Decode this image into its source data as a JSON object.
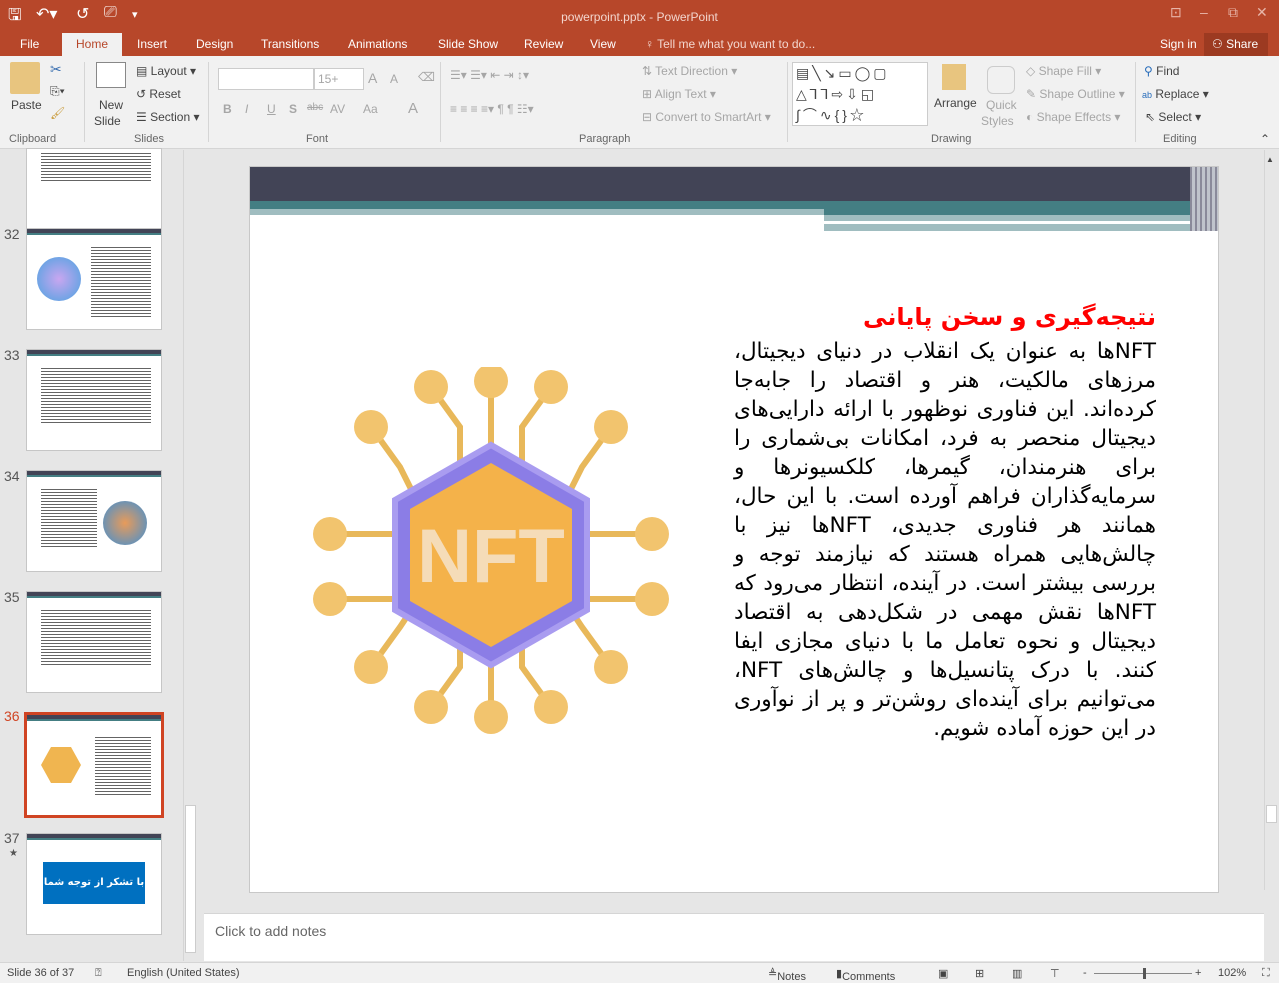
{
  "window": {
    "title": "powerpoint.pptx - PowerPoint"
  },
  "tabs": [
    {
      "label": "File"
    },
    {
      "label": "Home"
    },
    {
      "label": "Insert"
    },
    {
      "label": "Design"
    },
    {
      "label": "Transitions"
    },
    {
      "label": "Animations"
    },
    {
      "label": "Slide Show"
    },
    {
      "label": "Review"
    },
    {
      "label": "View"
    }
  ],
  "tell_me": "Tell me what you want to do...",
  "sign_in": "Sign in",
  "share": "Share",
  "ribbon": {
    "clipboard": {
      "label": "Clipboard",
      "paste": "Paste"
    },
    "slides": {
      "label": "Slides",
      "new_slide": "New",
      "new_slide2": "Slide",
      "layout": "Layout",
      "reset": "Reset",
      "section": "Section"
    },
    "font": {
      "label": "Font",
      "size": "15+",
      "bold": "B",
      "italic": "I",
      "underline": "U",
      "shadow": "S",
      "strike": "abc",
      "spacing": "AV",
      "case": "Aa",
      "color": "A",
      "grow": "A",
      "shrink": "A"
    },
    "paragraph": {
      "label": "Paragraph",
      "text_direction": "Text Direction",
      "align_text": "Align Text",
      "smartart": "Convert to SmartArt"
    },
    "drawing": {
      "label": "Drawing",
      "arrange": "Arrange",
      "quick_styles": "Quick",
      "quick_styles2": "Styles",
      "shape_fill": "Shape Fill",
      "shape_outline": "Shape Outline",
      "shape_effects": "Shape Effects"
    },
    "editing": {
      "label": "Editing",
      "find": "Find",
      "replace": "Replace",
      "select": "Select"
    }
  },
  "thumbnails": [
    {
      "num": "32"
    },
    {
      "num": "33"
    },
    {
      "num": "34"
    },
    {
      "num": "35"
    },
    {
      "num": "36",
      "selected": true
    },
    {
      "num": "37",
      "text": "با تشکر از توجه شما"
    }
  ],
  "slide": {
    "title": "نتیجه‌گیری و سخن پایانی",
    "body": "NFTها به عنوان یک انقلاب در دنیای دیجیتال، مرزهای مالکیت، هنر و اقتصاد را جابه‌جا کرده‌اند. این فناوری نوظهور با ارائه دارایی‌های دیجیتال منحصر به فرد، امکانات بی‌شماری را برای هنرمندان، گیمرها، کلکسیونرها و سرمایه‌گذاران فراهم آورده است. با این حال، همانند هر فناوری جدیدی، NFTها نیز با چالش‌هایی همراه هستند که نیازمند توجه و بررسی بیشتر است. در آینده، انتظار می‌رود که NFTها نقش مهمی در شکل‌دهی به اقتصاد دیجیتال و نحوه تعامل ما با دنیای مجازی ایفا کنند. با درک پتانسیل‌ها و چالش‌های NFT، می‌توانیم برای آینده‌ای روشن‌تر و پر از نوآوری در این حوزه آماده شویم.",
    "image_text": "NFT"
  },
  "notes_placeholder": "Click to add notes",
  "status": {
    "slide": "Slide 36 of 37",
    "language": "English (United States)",
    "notes": "Notes",
    "comments": "Comments",
    "zoom": "102%",
    "zoom_percent": 102
  },
  "colors": {
    "accent": "#b7472a",
    "header_dark": "#424456",
    "header_teal": "#447e83",
    "title_red": "#ff0000"
  }
}
